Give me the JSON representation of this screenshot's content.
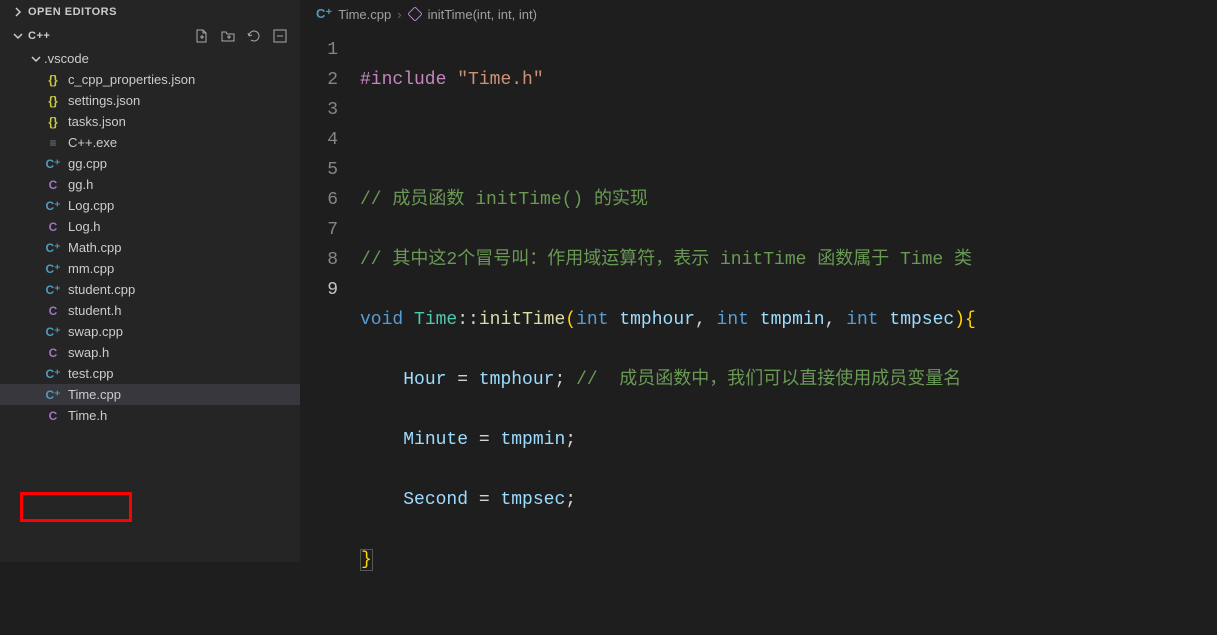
{
  "sidebar": {
    "openEditorsLabel": "OPEN EDITORS",
    "rootLabel": "C++",
    "vscodeFolder": ".vscode",
    "files": {
      "c_cpp_properties": "c_cpp_properties.json",
      "settings": "settings.json",
      "tasks": "tasks.json",
      "cppexe": "C++.exe",
      "ggcpp": "gg.cpp",
      "ggh": "gg.h",
      "logcpp": "Log.cpp",
      "logh": "Log.h",
      "mathcpp": "Math.cpp",
      "mmcpp": "mm.cpp",
      "studentcpp": "student.cpp",
      "studenth": "student.h",
      "swapcpp": "swap.cpp",
      "swaph": "swap.h",
      "testcpp": "test.cpp",
      "timecpp": "Time.cpp",
      "timeh": "Time.h"
    }
  },
  "breadcrumb": {
    "file": "Time.cpp",
    "symbol": "initTime(int, int, int)"
  },
  "code": {
    "l1": {
      "include": "#include",
      "str": "\"Time.h\""
    },
    "l3": "// 成员函数 initTime() 的实现",
    "l4": "// 其中这2个冒号叫：作用域运算符，表示 initTime 函数属于 Time 类",
    "l5": {
      "void": "void",
      "type": "Time",
      "sep": "::",
      "func": "initTime",
      "p1t": "int",
      "p1n": "tmphour",
      "p2t": "int",
      "p2n": "tmpmin",
      "p3t": "int",
      "p3n": "tmpsec"
    },
    "l6": {
      "var": "Hour",
      "op": " = ",
      "val": "tmphour",
      "comment": "//  成员函数中，我们可以直接使用成员变量名"
    },
    "l7": {
      "var": "Minute",
      "op": " = ",
      "val": "tmpmin"
    },
    "l8": {
      "var": "Second",
      "op": " = ",
      "val": "tmpsec"
    }
  },
  "lineNumbers": [
    "1",
    "2",
    "3",
    "4",
    "5",
    "6",
    "7",
    "8",
    "9"
  ]
}
